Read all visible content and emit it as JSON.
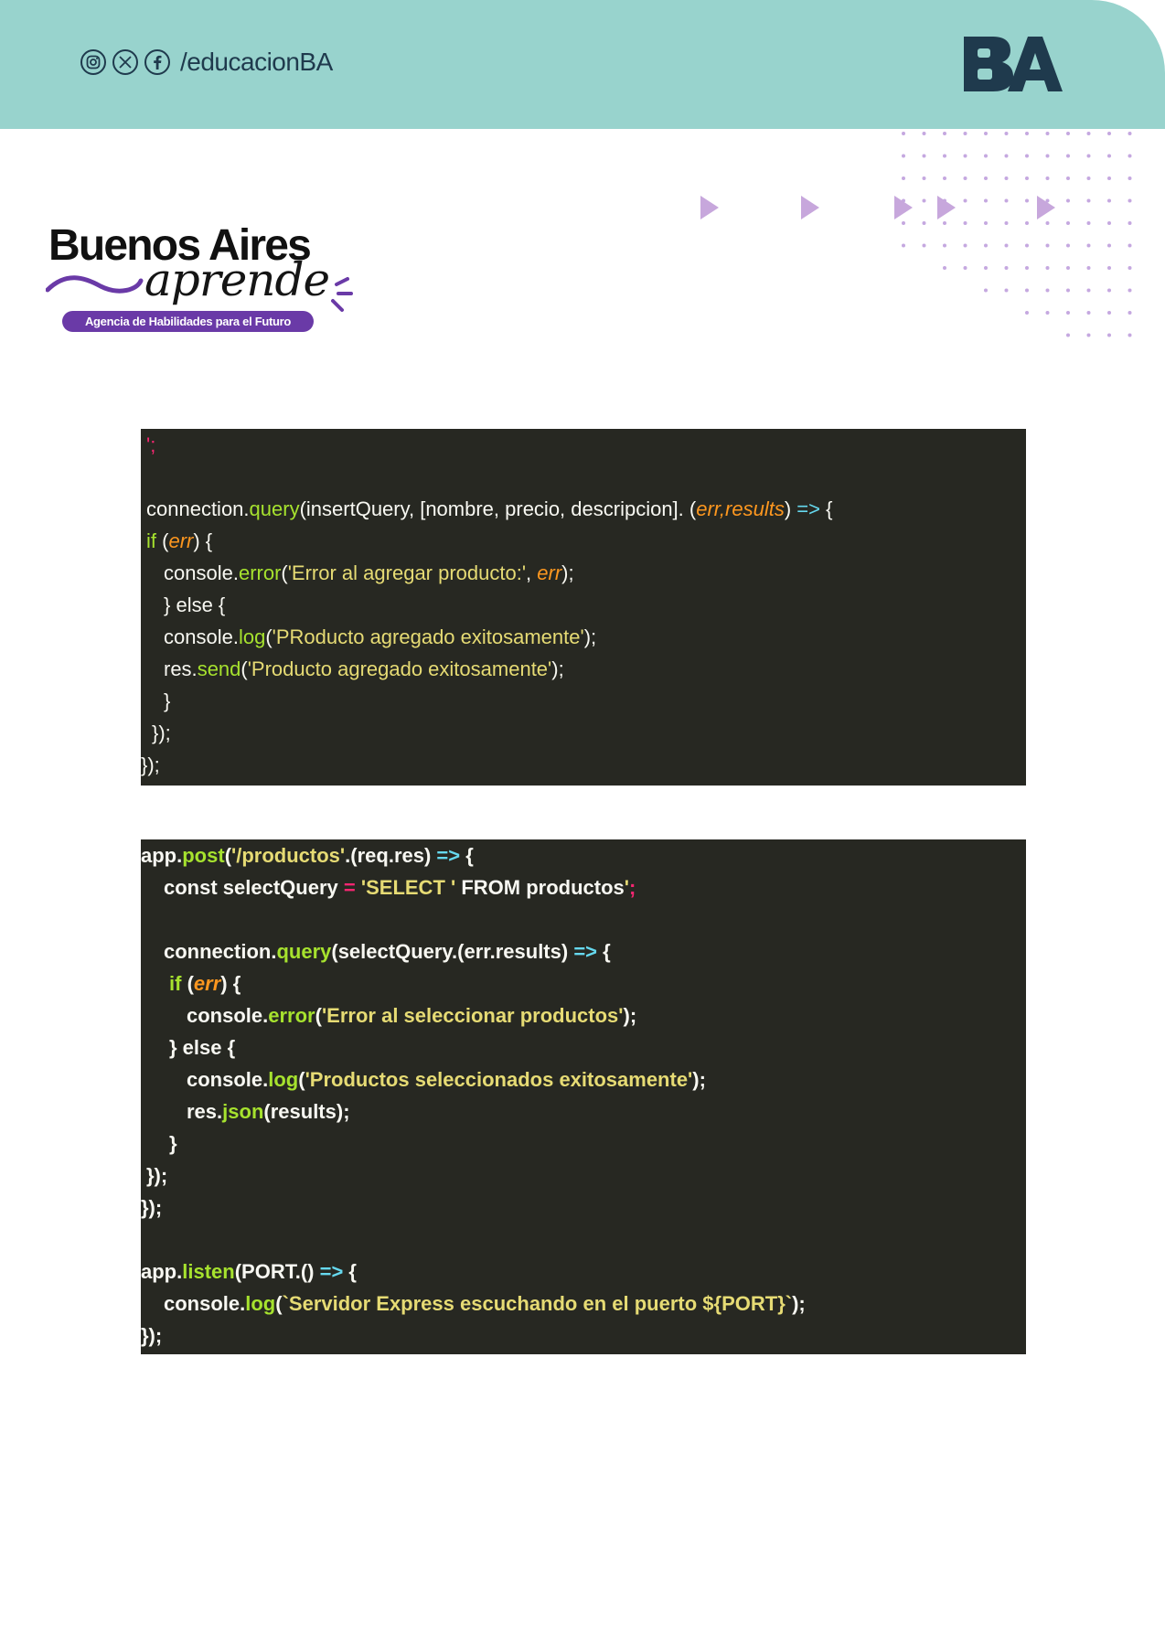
{
  "header": {
    "social_handle": "/educacionBA",
    "social_icons": [
      "instagram-icon",
      "x-icon",
      "facebook-icon"
    ],
    "brand": "BA",
    "background_color": "#98d3cd"
  },
  "logo": {
    "title": "Buenos Aires",
    "script": "aprende",
    "tagline": "Agencia de Habilidades para el Futuro",
    "accent_color": "#6a3aa7"
  },
  "code_block_1": {
    "l0": "';",
    "l2a": "connection.",
    "l2b": "query",
    "l2c": "(insertQuery, [nombre, precio, descripcion]. (",
    "l2d": "err",
    "l2e": ",",
    "l2f": "results",
    "l2g": ") ",
    "l2h": "=>",
    "l2i": " {",
    "l3a": "if",
    "l3b": " (",
    "l3c": "err",
    "l3d": ") {",
    "l4a": "console.",
    "l4b": "error",
    "l4c": "(",
    "l4d": "'Error al agregar producto:'",
    "l4e": ", ",
    "l4f": "err",
    "l4g": ");",
    "l5": "} else {",
    "l6a": "console.",
    "l6b": "log",
    "l6c": "(",
    "l6d": "'PRoducto agregado exitosamente'",
    "l6e": ");",
    "l7a": "res.",
    "l7b": "send",
    "l7c": "(",
    "l7d": "'Producto agregado exitosamente'",
    "l7e": ");",
    "l8": "}",
    "l9": "});",
    "l10": "});"
  },
  "code_block_2": {
    "l0a": "app.",
    "l0b": "post",
    "l0c": "(",
    "l0d": "'/productos'",
    "l0e": ".(req.res) ",
    "l0f": "=>",
    "l0g": " {",
    "l1a": "const selectQuery ",
    "l1b": "=",
    "l1c": " ",
    "l1d": "'SELECT '",
    "l1e": " FROM productos",
    "l1f": "'",
    "l1g": ";",
    "l3a": "connection.",
    "l3b": "query",
    "l3c": "(selectQuery.(err.results) ",
    "l3d": "=>",
    "l3e": " {",
    "l4a": "if",
    "l4b": " (",
    "l4c": "err",
    "l4d": ") {",
    "l5a": "console.",
    "l5b": "error",
    "l5c": "(",
    "l5d": "'Error al seleccionar productos'",
    "l5e": ");",
    "l6": "} else {",
    "l7a": "console.",
    "l7b": "log",
    "l7c": "(",
    "l7d": "'Productos seleccionados exitosamente'",
    "l7e": ");",
    "l8a": "res.",
    "l8b": "json",
    "l8c": "(results);",
    "l9": "}",
    "l10": "});",
    "l11": "});",
    "l13a": "app.",
    "l13b": "listen",
    "l13c": "(PORT.() ",
    "l13d": "=>",
    "l13e": " {",
    "l14a": "console.",
    "l14b": "log",
    "l14c": "(",
    "l14d": "`Servidor Express escuchando en el puerto ${PORT}`",
    "l14e": ");",
    "l15": "});"
  }
}
